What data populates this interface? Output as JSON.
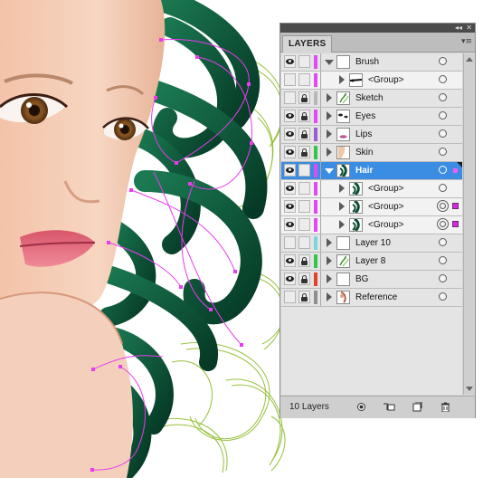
{
  "panel": {
    "tab_label": "LAYERS",
    "collapse_glyph": "◂◂",
    "close_glyph": "✕",
    "menu_glyph": "▾≡",
    "footer_count": "10 Layers"
  },
  "icons": {
    "visibility": "eye-icon",
    "lock": "lock-icon",
    "target": "target-circle-icon",
    "footer_buttons": [
      "make-clipping-mask-icon",
      "create-sublayer-icon",
      "create-new-layer-icon",
      "delete-layer-icon"
    ]
  },
  "colors": {
    "selection": "#3a8de2",
    "artwork_hair": "#0f5a3c",
    "artwork_sketch": "#96c13c",
    "path_magenta": "#e83cf0"
  },
  "layers": [
    {
      "name": "Brush",
      "visible": true,
      "locked": false,
      "color": "#e04af2",
      "expanded": true,
      "sub": false,
      "selected": false,
      "target": "single",
      "thumb": "blank-thumbnail"
    },
    {
      "name": "<Group>",
      "visible": false,
      "locked": false,
      "color": "#e04af2",
      "expanded": false,
      "sub": true,
      "selected": false,
      "target": "single",
      "thumb": "brush-stroke-thumbnail"
    },
    {
      "name": "Sketch",
      "visible": false,
      "locked": true,
      "color": "#b8b8b8",
      "expanded": false,
      "sub": false,
      "selected": false,
      "target": "single",
      "thumb": "sketch-thumbnail"
    },
    {
      "name": "Eyes",
      "visible": true,
      "locked": true,
      "color": "#e04af2",
      "expanded": false,
      "sub": false,
      "selected": false,
      "target": "single",
      "thumb": "eyes-thumbnail"
    },
    {
      "name": "Lips",
      "visible": true,
      "locked": true,
      "color": "#9a5cd0",
      "expanded": false,
      "sub": false,
      "selected": false,
      "target": "single",
      "thumb": "lips-thumbnail"
    },
    {
      "name": "Skin",
      "visible": true,
      "locked": true,
      "color": "#34c44a",
      "expanded": false,
      "sub": false,
      "selected": false,
      "target": "single",
      "thumb": "skin-thumbnail"
    },
    {
      "name": "Hair",
      "visible": true,
      "locked": false,
      "color": "#e04af2",
      "expanded": true,
      "sub": false,
      "selected": true,
      "target": "single",
      "thumb": "hair-thumbnail"
    },
    {
      "name": "<Group>",
      "visible": true,
      "locked": false,
      "color": "#e04af2",
      "expanded": false,
      "sub": true,
      "selected": false,
      "target": "single",
      "thumb": "hair-thumbnail"
    },
    {
      "name": "<Group>",
      "visible": true,
      "locked": false,
      "color": "#e04af2",
      "expanded": false,
      "sub": true,
      "selected": false,
      "target": "double",
      "thumb": "hair-thumbnail",
      "sel_color": "#d62ae0"
    },
    {
      "name": "<Group>",
      "visible": true,
      "locked": false,
      "color": "#e04af2",
      "expanded": false,
      "sub": true,
      "selected": false,
      "target": "double",
      "thumb": "hair-thumbnail",
      "sel_color": "#d62ae0"
    },
    {
      "name": "Layer 10",
      "visible": false,
      "locked": false,
      "color": "#7ed6dc",
      "expanded": false,
      "sub": false,
      "selected": false,
      "target": "single",
      "thumb": "blank-thumbnail"
    },
    {
      "name": "Layer 8",
      "visible": true,
      "locked": true,
      "color": "#34c44a",
      "expanded": false,
      "sub": false,
      "selected": false,
      "target": "single",
      "thumb": "sketch-thumbnail"
    },
    {
      "name": "BG",
      "visible": true,
      "locked": true,
      "color": "#e5422c",
      "expanded": false,
      "sub": false,
      "selected": false,
      "target": "single",
      "thumb": "blank-thumbnail"
    },
    {
      "name": "Reference",
      "visible": false,
      "locked": true,
      "color": "#8e8e8e",
      "expanded": false,
      "sub": false,
      "selected": false,
      "target": "single",
      "thumb": "reference-thumbnail"
    }
  ]
}
